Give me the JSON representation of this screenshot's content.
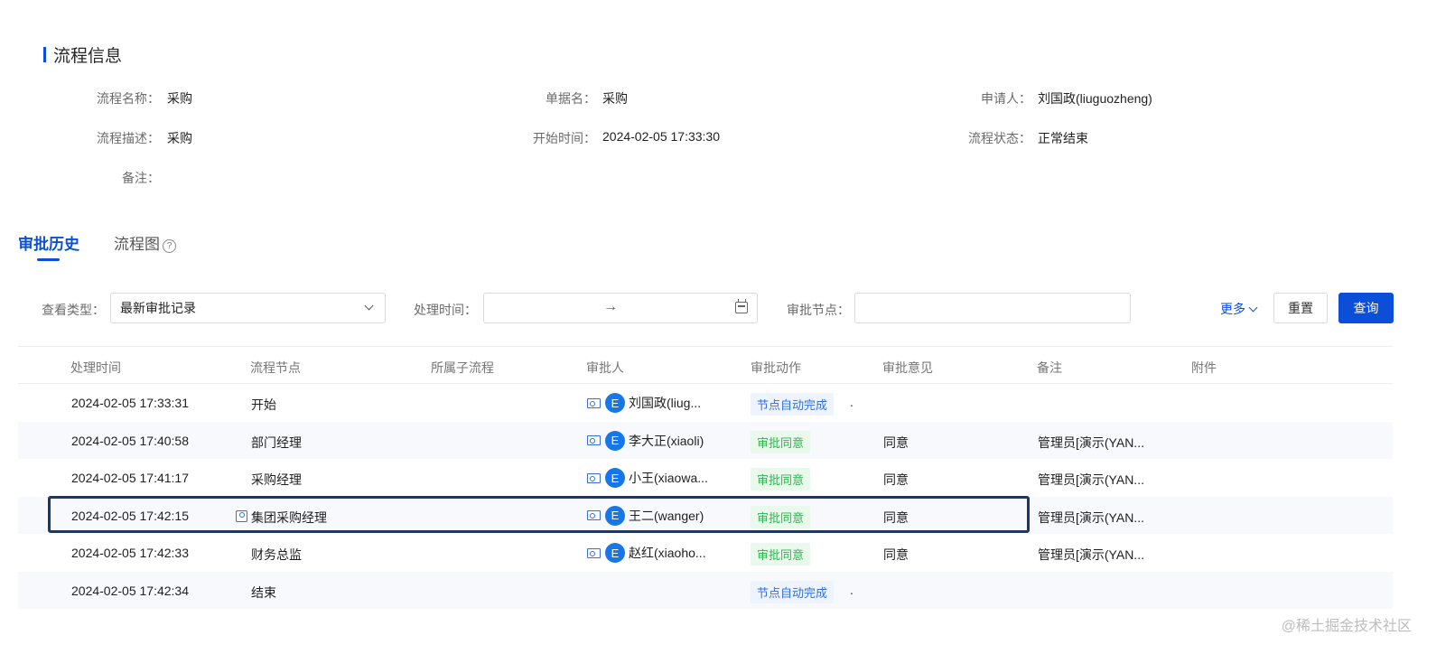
{
  "section": {
    "title": "流程信息"
  },
  "info": {
    "process_name_label": "流程名称：",
    "process_name": "采购",
    "doc_name_label": "单据名：",
    "doc_name": "采购",
    "applicant_label": "申请人：",
    "applicant": "刘国政(liuguozheng)",
    "process_desc_label": "流程描述：",
    "process_desc": "采购",
    "start_time_label": "开始时间：",
    "start_time": "2024-02-05 17:33:30",
    "process_status_label": "流程状态：",
    "process_status": "正常结束",
    "remark_label": "备注：",
    "remark": ""
  },
  "tabs": [
    {
      "label": "审批历史",
      "active": true
    },
    {
      "label": "流程图",
      "active": false,
      "help": "?"
    }
  ],
  "filters": {
    "view_type_label": "查看类型：",
    "view_type_value": "最新审批记录",
    "process_time_label": "处理时间：",
    "range_separator": "→",
    "approval_node_label": "审批节点：",
    "more": "更多",
    "reset": "重置",
    "query": "查询"
  },
  "table": {
    "columns": [
      "处理时间",
      "流程节点",
      "所属子流程",
      "审批人",
      "审批动作",
      "审批意见",
      "备注",
      "附件"
    ],
    "rows": [
      {
        "time": "2024-02-05 17:33:31",
        "node": "开始",
        "approver_initial": "E",
        "approver": "刘国政(liug...",
        "action": "节点自动完成",
        "action_type": "auto",
        "dot": ".",
        "opinion": "",
        "remark": ""
      },
      {
        "time": "2024-02-05 17:40:58",
        "node": "部门经理",
        "approver_initial": "E",
        "approver": "李大正(xiaoli)",
        "action": "审批同意",
        "action_type": "agree",
        "opinion": "同意",
        "remark": "管理员[演示(YAN..."
      },
      {
        "time": "2024-02-05 17:41:17",
        "node": "采购经理",
        "approver_initial": "E",
        "approver": "小王(xiaowa...",
        "action": "审批同意",
        "action_type": "agree",
        "opinion": "同意",
        "remark": "管理员[演示(YAN..."
      },
      {
        "time": "2024-02-05 17:42:15",
        "node": "集团采购经理",
        "approver_initial": "E",
        "approver": "王二(wanger)",
        "action": "审批同意",
        "action_type": "agree",
        "opinion": "同意",
        "remark": "管理员[演示(YAN..."
      },
      {
        "time": "2024-02-05 17:42:33",
        "node": "财务总监",
        "approver_initial": "E",
        "approver": "赵红(xiaoho...",
        "action": "审批同意",
        "action_type": "agree",
        "opinion": "同意",
        "remark": "管理员[演示(YAN..."
      },
      {
        "time": "2024-02-05 17:42:34",
        "node": "结束",
        "action": "节点自动完成",
        "action_type": "auto",
        "dot": ".",
        "opinion": "",
        "remark": ""
      }
    ]
  },
  "watermark": "@稀土掘金技术社区"
}
